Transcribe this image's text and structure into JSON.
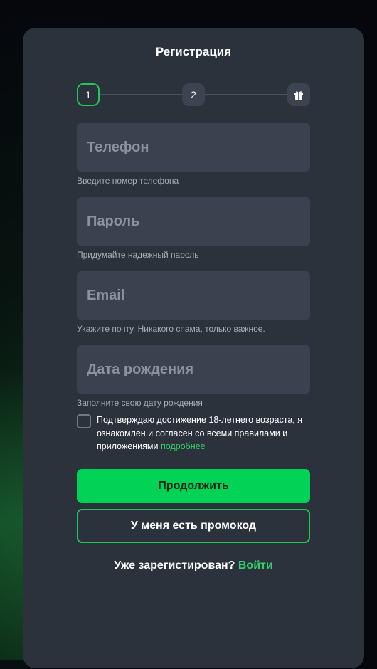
{
  "modal": {
    "title": "Регистрация"
  },
  "stepper": {
    "step1": "1",
    "step2": "2",
    "step3_icon": "gift-icon"
  },
  "fields": {
    "phone": {
      "placeholder": "Телефон",
      "hint": "Введите номер телефона"
    },
    "password": {
      "placeholder": "Пароль",
      "hint": "Придумайте надежный пароль"
    },
    "email": {
      "placeholder": "Email",
      "hint": "Укажите почту. Никакого спама, только важное."
    },
    "birthdate": {
      "placeholder": "Дата рождения",
      "hint": "Заполните свою дату рождения"
    }
  },
  "consent": {
    "text": "Подтверждаю достижение 18-летнего возраста, я ознакомлен и согласен со всеми правилами и приложениями",
    "link": "подробнее"
  },
  "buttons": {
    "continue": "Продолжить",
    "promo": "У меня есть промокод"
  },
  "login": {
    "prompt": "Уже зарегистирован?",
    "link": "Войти"
  },
  "colors": {
    "accent": "#00d355",
    "modal_bg": "#2b323c",
    "field_bg": "#3a424f"
  }
}
